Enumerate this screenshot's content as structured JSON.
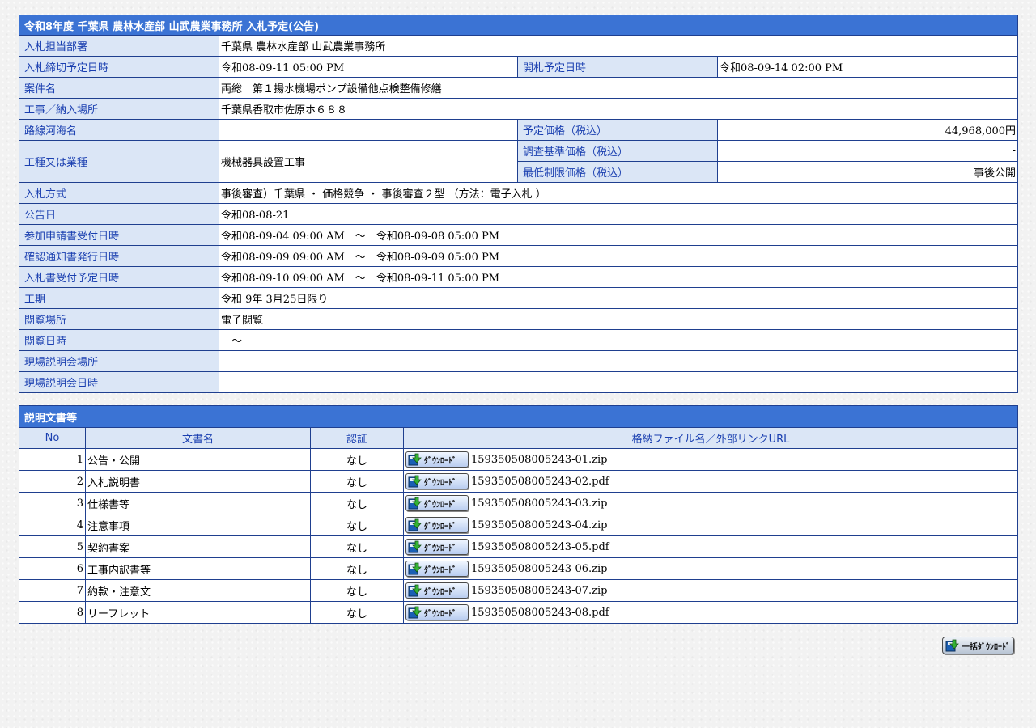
{
  "info": {
    "caption": "令和8年度 千葉県 農林水産部 山武農業事務所 入札予定(公告)",
    "dept_label": "入札担当部署",
    "dept_value": "千葉県 農林水産部 山武農業事務所",
    "deadline_label": "入札締切予定日時",
    "deadline_value": "令和08-09-11 05:00 PM",
    "opening_label": "開札予定日時",
    "opening_value": "令和08-09-14 02:00 PM",
    "project_label": "案件名",
    "project_value": "両総　第１揚水機場ポンプ設備他点検整備修繕",
    "location_label": "工事／納入場所",
    "location_value": "千葉県香取市佐原ホ６８８",
    "route_label": "路線河海名",
    "route_value": "",
    "planned_price_label": "予定価格（税込）",
    "planned_price_value": "44,968,000円",
    "category_label": "工種又は業種",
    "category_value": "機械器具設置工事",
    "survey_price_label": "調査基準価格（税込）",
    "survey_price_value": "-",
    "min_price_label": "最低制限価格（税込）",
    "min_price_value": "事後公開",
    "method_label": "入札方式",
    "method_value": "事後審査）千葉県 ・ 価格競争 ・ 事後審査２型 （方法：電子入札 ）",
    "notice_date_label": "公告日",
    "notice_date_value": "令和08-08-21",
    "application_label": "参加申請書受付日時",
    "application_value": "令和08-09-04 09:00 AM　～　令和08-09-08 05:00 PM",
    "confirm_label": "確認通知書発行日時",
    "confirm_value": "令和08-09-09 09:00 AM　～　令和08-09-09 05:00 PM",
    "bid_receipt_label": "入札書受付予定日時",
    "bid_receipt_value": "令和08-09-10 09:00 AM　～　令和08-09-11 05:00 PM",
    "period_label": "工期",
    "period_value": "令和 9年 3月25日限り",
    "view_place_label": "閲覧場所",
    "view_place_value": "電子閲覧",
    "view_date_label": "閲覧日時",
    "view_date_value": "　～",
    "briefing_place_label": "現場説明会場所",
    "briefing_place_value": "",
    "briefing_date_label": "現場説明会日時",
    "briefing_date_value": ""
  },
  "docs": {
    "caption": "説明文書等",
    "col_no": "No",
    "col_name": "文書名",
    "col_auth": "認証",
    "col_file": "格納ファイル名／外部リンクURL",
    "download_label": "ﾀﾞｳﾝﾛｰﾄﾞ",
    "rows": [
      {
        "no": "1",
        "name": "公告・公開",
        "auth": "なし",
        "file": "159350508005243-01.zip"
      },
      {
        "no": "2",
        "name": "入札説明書",
        "auth": "なし",
        "file": "159350508005243-02.pdf"
      },
      {
        "no": "3",
        "name": "仕様書等",
        "auth": "なし",
        "file": "159350508005243-03.zip"
      },
      {
        "no": "4",
        "name": "注意事項",
        "auth": "なし",
        "file": "159350508005243-04.zip"
      },
      {
        "no": "5",
        "name": "契約書案",
        "auth": "なし",
        "file": "159350508005243-05.pdf"
      },
      {
        "no": "6",
        "name": "工事内訳書等",
        "auth": "なし",
        "file": "159350508005243-06.zip"
      },
      {
        "no": "7",
        "name": "約款・注意文",
        "auth": "なし",
        "file": "159350508005243-07.zip"
      },
      {
        "no": "8",
        "name": "リーフレット",
        "auth": "なし",
        "file": "159350508005243-08.pdf"
      }
    ]
  },
  "bulk_download_label": "一括ﾀﾞｳﾝﾛｰﾄﾞ",
  "icon_name": "download-icon",
  "colors": {
    "caption_bg": "#3b73d4",
    "label_bg": "#dbe6f6",
    "label_text": "#1a3fb0",
    "border": "#1f3f8f"
  }
}
